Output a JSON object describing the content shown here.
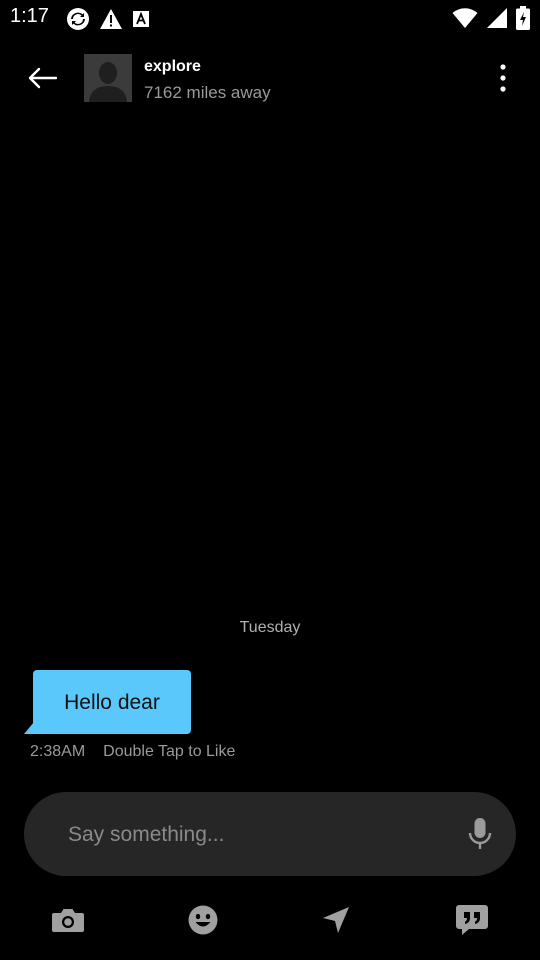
{
  "status_bar": {
    "time": "1:17",
    "left_icons": [
      "sync-icon",
      "warning-icon",
      "a-badge-icon"
    ],
    "right_icons": [
      "wifi-icon",
      "signal-icon",
      "battery-icon"
    ]
  },
  "header": {
    "title": "explore",
    "subtitle": "7162 miles away",
    "back_icon": "back-arrow-icon",
    "more_icon": "more-vert-icon",
    "avatar_icon": "default-avatar-icon"
  },
  "conversation": {
    "day_label": "Tuesday",
    "messages": [
      {
        "text": "Hello dear",
        "time": "2:38AM",
        "hint": "Double Tap to Like"
      }
    ]
  },
  "composer": {
    "placeholder": "Say something...",
    "value": "",
    "mic_icon": "mic-icon"
  },
  "toolbar": {
    "items": [
      "camera-icon",
      "emoji-icon",
      "location-icon",
      "quick-reply-icon"
    ]
  },
  "colors": {
    "background": "#000000",
    "bubble": "#5ac8fa",
    "input_bg": "#262626",
    "muted_text": "#9a9a9a",
    "icon_gray": "#a0a0a0"
  }
}
